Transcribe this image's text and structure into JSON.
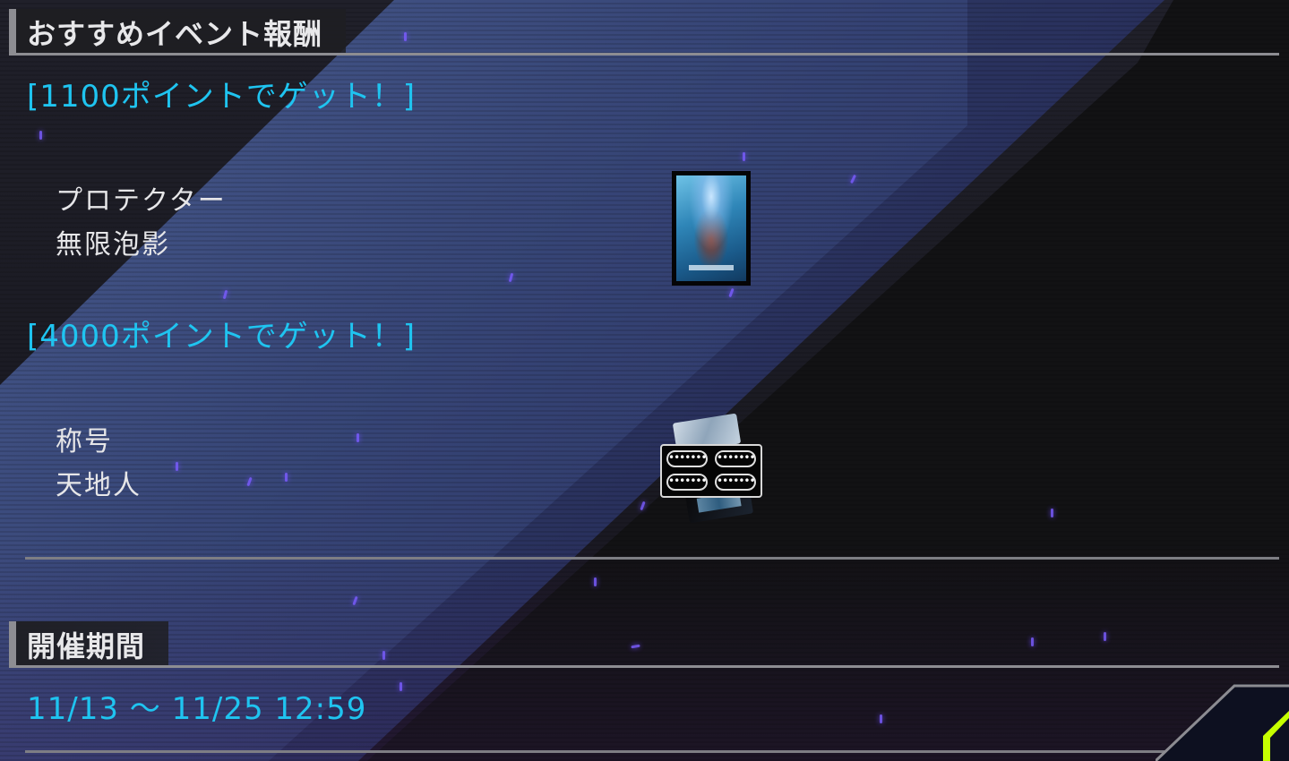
{
  "rewards_section": {
    "title": "おすすめイベント報酬"
  },
  "tiers": [
    {
      "heading": "[1100ポイントでゲット！]",
      "item_type": "プロテクター",
      "item_name": "無限泡影",
      "icon": "protector-card-image"
    },
    {
      "heading": "[4000ポイントでゲット！]",
      "item_type": "称号",
      "item_name": "天地人",
      "icon": "title-badge-image",
      "badge_pills": [
        "•••••••",
        "•••••••",
        "•••••••",
        "•••••••"
      ]
    }
  ],
  "period_section": {
    "title": "開催期間",
    "value": "11/13 ～ 11/25 12:59"
  },
  "colors": {
    "accent_cyan": "#1fc4f0",
    "header_text": "#e8e8ea",
    "rule_gray": "#8d8d92",
    "sparkle_purple": "#7a5cff",
    "corner_accent_green": "#c6ff00"
  }
}
